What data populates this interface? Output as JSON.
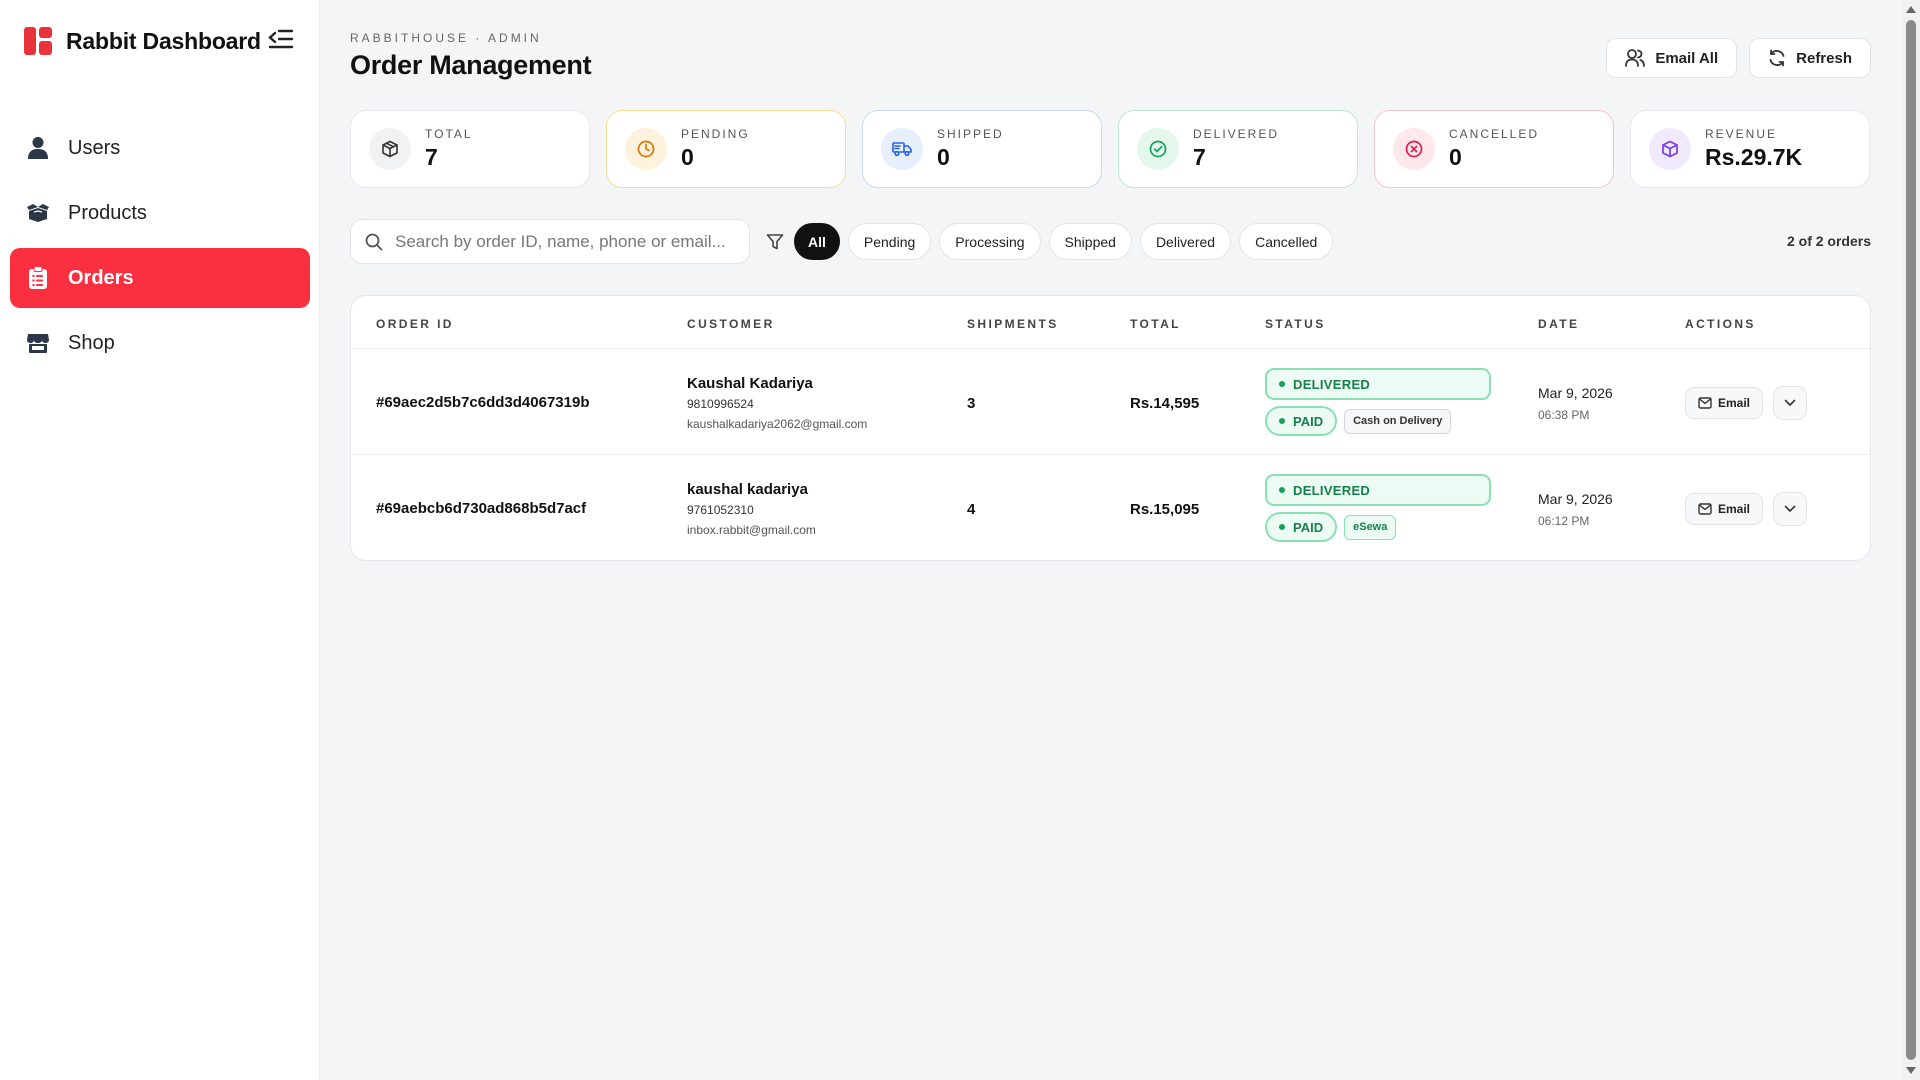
{
  "app": {
    "title": "Rabbit Dashboard"
  },
  "sidebar": {
    "items": [
      {
        "label": "Users",
        "icon": "user-icon",
        "active": false
      },
      {
        "label": "Products",
        "icon": "boxes-icon",
        "active": false
      },
      {
        "label": "Orders",
        "icon": "clipboard-icon",
        "active": true
      },
      {
        "label": "Shop",
        "icon": "store-icon",
        "active": false
      }
    ]
  },
  "header": {
    "eyebrow": "RABBITHOUSE · ADMIN",
    "title": "Order Management",
    "email_all_label": "Email All",
    "refresh_label": "Refresh"
  },
  "stats": [
    {
      "label": "TOTAL",
      "value": "7",
      "icon": "box-icon"
    },
    {
      "label": "PENDING",
      "value": "0",
      "icon": "clock-icon"
    },
    {
      "label": "SHIPPED",
      "value": "0",
      "icon": "truck-icon"
    },
    {
      "label": "DELIVERED",
      "value": "7",
      "icon": "check-circle-icon"
    },
    {
      "label": "CANCELLED",
      "value": "0",
      "icon": "x-circle-icon"
    },
    {
      "label": "REVENUE",
      "value": "Rs.29.7K",
      "icon": "package-icon"
    }
  ],
  "filters": {
    "search_placeholder": "Search by order ID, name, phone or email...",
    "chips": [
      "All",
      "Pending",
      "Processing",
      "Shipped",
      "Delivered",
      "Cancelled"
    ],
    "active_chip": "All",
    "count_text": "2 of 2 orders"
  },
  "table": {
    "columns": [
      "ORDER ID",
      "CUSTOMER",
      "SHIPMENTS",
      "TOTAL",
      "STATUS",
      "DATE",
      "ACTIONS"
    ],
    "rows": [
      {
        "order_id": "#69aec2d5b7c6dd3d4067319b",
        "customer_name": "Kaushal Kadariya",
        "customer_phone": "9810996524",
        "customer_email": "kaushalkadariya2062@gmail.com",
        "shipments": "3",
        "total": "Rs.14,595",
        "status": "DELIVERED",
        "payment": "PAID",
        "method": "Cash on Delivery",
        "date": "Mar 9, 2026",
        "time": "06:38 PM",
        "email_label": "Email"
      },
      {
        "order_id": "#69aebcb6d730ad868b5d7acf",
        "customer_name": "kaushal kadariya",
        "customer_phone": "9761052310",
        "customer_email": "inbox.rabbit@gmail.com",
        "shipments": "4",
        "total": "Rs.15,095",
        "status": "DELIVERED",
        "payment": "PAID",
        "method": "eSewa",
        "date": "Mar 9, 2026",
        "time": "06:12 PM",
        "email_label": "Email"
      }
    ]
  },
  "colors": {
    "accent": "#fa3040",
    "success": "#15804a",
    "background": "#f4f5f7"
  }
}
